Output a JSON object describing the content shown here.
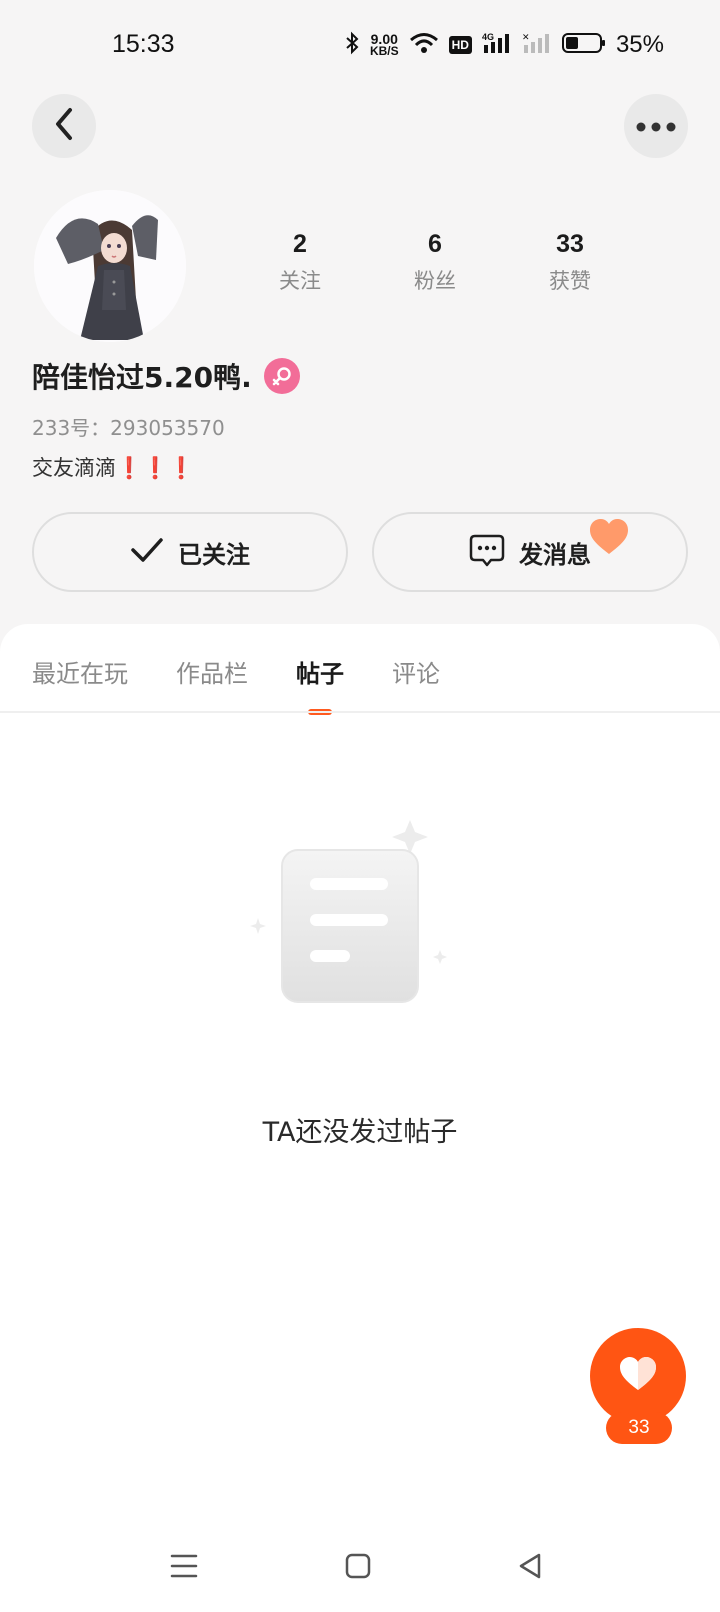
{
  "status_bar": {
    "time": "15:33",
    "net_speed_value": "9.00",
    "net_speed_unit": "KB/S",
    "hd_label": "HD",
    "battery_percent": "35%",
    "icons": [
      "bluetooth-icon",
      "wifi-icon",
      "hd-icon",
      "signal-4g-icon",
      "signal-2-icon",
      "battery-icon"
    ]
  },
  "nav": {
    "back_icon": "chevron-left-icon",
    "more_icon": "more-dots-icon"
  },
  "profile": {
    "stats": [
      {
        "value": "2",
        "label": "关注"
      },
      {
        "value": "6",
        "label": "粉丝"
      },
      {
        "value": "33",
        "label": "获赞"
      }
    ],
    "username": "陪佳怡过5.20鸭.",
    "gender_icon": "female-icon",
    "uid": "233号：293053570",
    "bio_text": "交友滴滴",
    "bio_marks": "❗❗❗"
  },
  "actions": {
    "follow_label": "已关注",
    "message_label": "发消息"
  },
  "tabs": [
    {
      "label": "最近在玩",
      "active": false
    },
    {
      "label": "作品栏",
      "active": false
    },
    {
      "label": "帖子",
      "active": true
    },
    {
      "label": "评论",
      "active": false
    }
  ],
  "empty_state": {
    "message": "TA还没发过帖子"
  },
  "like_fab": {
    "count": "33"
  },
  "colors": {
    "accent": "#ff5513",
    "gender_pink": "#f26d98",
    "heart_deco": "#ff9a6a"
  }
}
